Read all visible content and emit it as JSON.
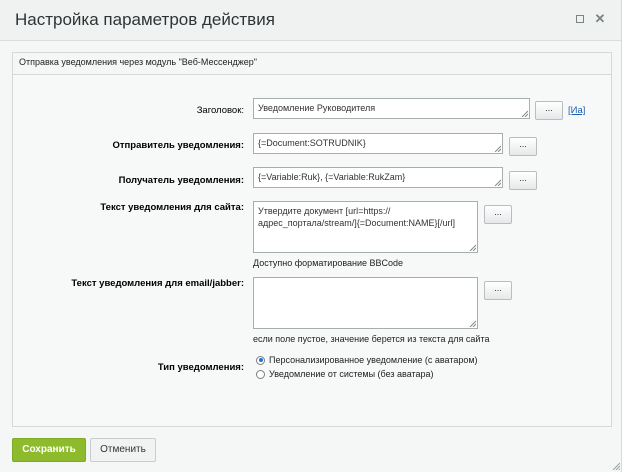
{
  "window": {
    "title": "Настройка параметров действия"
  },
  "icons": {
    "maximize": "maximize-icon",
    "close": "close-icon"
  },
  "panel": {
    "header": "Отправка уведомления через модуль \"Веб-Мессенджер\""
  },
  "form": {
    "subject": {
      "label": "Заголовок:",
      "value": "Уведомление Руководителя",
      "button": "...",
      "link": "[Иа]"
    },
    "sender": {
      "label": "Отправитель уведомления:",
      "value": "{=Document:SOTRUDNIK}",
      "button": "..."
    },
    "recipient": {
      "label": "Получатель уведомления:",
      "value": "{=Variable:Ruk}, {=Variable:RukZam}",
      "button": "..."
    },
    "site_text": {
      "label": "Текст уведомления для сайта:",
      "value_line1": "Утвердите документ [url=https://",
      "value_line2": "адрес_портала/stream/]{=Document:NAME}[/url]",
      "button": "...",
      "hint": "Доступно форматирование BBCode"
    },
    "email_text": {
      "label": "Текст уведомления для email/jabber:",
      "value": "",
      "button": "...",
      "hint": "если поле пустое, значение берется из текста для сайта"
    },
    "type": {
      "label": "Тип уведомления:",
      "options": [
        {
          "label": "Персонализированное уведомление (с аватаром)",
          "checked": true
        },
        {
          "label": "Уведомление от системы (без аватара)",
          "checked": false
        }
      ]
    }
  },
  "footer": {
    "save": "Сохранить",
    "cancel": "Отменить"
  },
  "colors": {
    "save_green": "#8dbb2b",
    "link_blue": "#1a5fb4",
    "radio_blue": "#1f72d6"
  }
}
